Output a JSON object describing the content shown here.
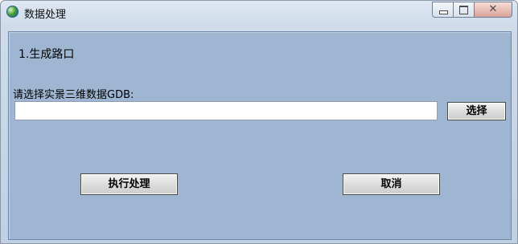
{
  "window": {
    "title": "数据处理",
    "icon": "globe-icon",
    "controls": {
      "minimize": "minimize-icon",
      "maximize": "maximize-icon",
      "close_glyph": "✕"
    }
  },
  "main": {
    "section_title": "1.生成路口",
    "gdb_label": "请选择实景三维数据GDB:",
    "gdb_input": {
      "value": "",
      "placeholder": ""
    },
    "select_button": "选择",
    "execute_button": "执行处理",
    "cancel_button": "取消"
  },
  "colors": {
    "client_bg": "#9eb6d2",
    "title_bg": "#cfdbe9",
    "close_button": "#d9a397"
  }
}
